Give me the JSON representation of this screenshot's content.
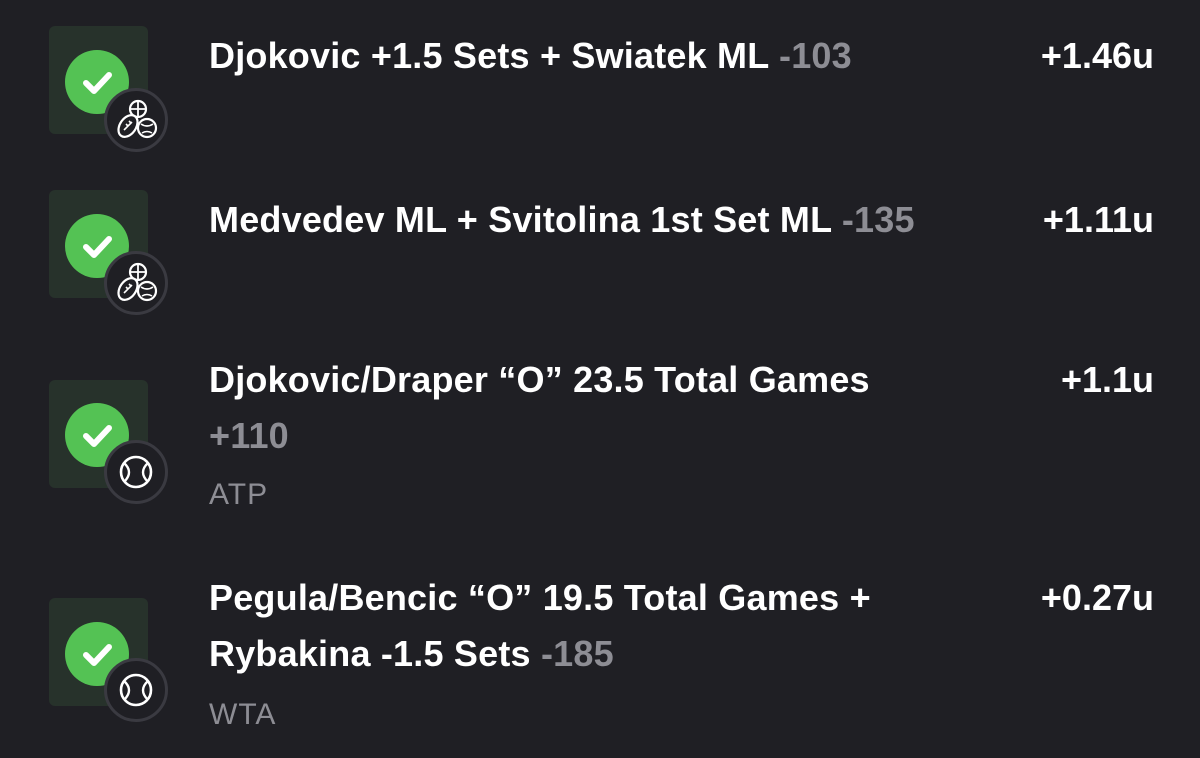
{
  "bets": [
    {
      "title": "Djokovic +1.5 Sets + Swiatek ML",
      "odds": "-103",
      "units": "+1.46u",
      "league": "",
      "status_icon": "check-circle-icon",
      "sport_icon": "multi-sport-icon",
      "status_color": "#54c254"
    },
    {
      "title": "Medvedev ML + Svitolina 1st Set ML",
      "odds": "-135",
      "units": "+1.11u",
      "league": "",
      "status_icon": "check-circle-icon",
      "sport_icon": "multi-sport-icon",
      "status_color": "#54c254"
    },
    {
      "title": "Djokovic/Draper “O” 23.5 Total Games",
      "odds": "+110",
      "units": "+1.1u",
      "league": "ATP",
      "status_icon": "check-circle-icon",
      "sport_icon": "tennis-ball-icon",
      "status_color": "#54c254"
    },
    {
      "title": "Pegula/Bencic “O” 19.5 Total Games +",
      "title_line2": "Rybakina -1.5 Sets",
      "odds": "-185",
      "units": "+0.27u",
      "league": "WTA",
      "status_icon": "check-circle-icon",
      "sport_icon": "tennis-ball-icon",
      "status_color": "#54c254"
    }
  ],
  "colors": {
    "background": "#1f1f24",
    "text": "#ffffff",
    "muted": "#8d8d94",
    "success": "#54c254"
  }
}
